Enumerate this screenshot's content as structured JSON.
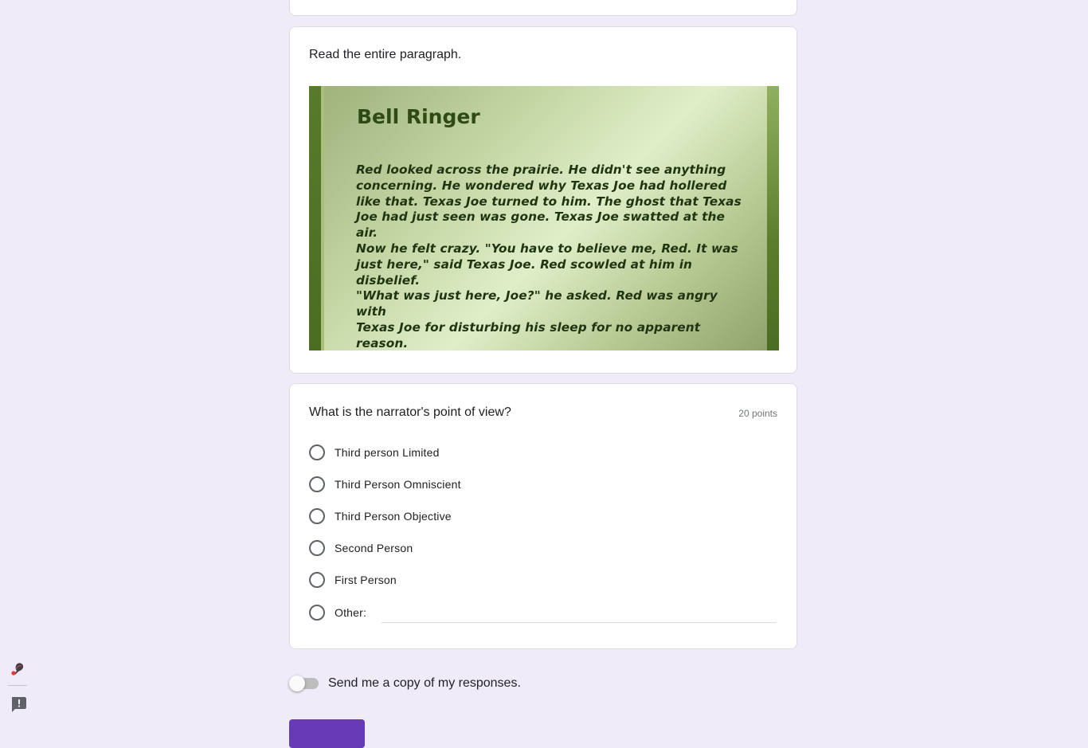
{
  "image_section": {
    "title": "Read the entire paragraph.",
    "slide": {
      "heading": "Bell Ringer",
      "lines": [
        "Red looked across the prairie. He didn't see anything",
        "concerning. He wondered why Texas Joe had hollered",
        "like that. Texas Joe turned to him. The ghost that Texas",
        "Joe had just seen was gone. Texas Joe swatted at the air.",
        "Now he felt crazy. \"You have to believe me, Red. It was",
        "just here,\" said Texas Joe. Red scowled at him in disbelief.",
        "\"What was just here, Joe?\" he asked. Red was angry with",
        "Texas Joe for disturbing his sleep for no apparent reason."
      ]
    }
  },
  "question": {
    "title": "What is the narrator's point of view?",
    "points": "20 points",
    "options": [
      {
        "label": "Third person Limited"
      },
      {
        "label": "Third Person Omniscient"
      },
      {
        "label": "Third Person Objective"
      },
      {
        "label": "Second Person"
      },
      {
        "label": "First Person"
      },
      {
        "label": "Other:"
      }
    ],
    "other_value": ""
  },
  "copy_responses": {
    "label": "Send me a copy of my responses.",
    "enabled": false
  },
  "colors": {
    "page_background": "#f0ebf8",
    "accent": "#673ab7"
  },
  "icons": {
    "top": "pin-icon",
    "bottom": "report-issue-icon"
  }
}
